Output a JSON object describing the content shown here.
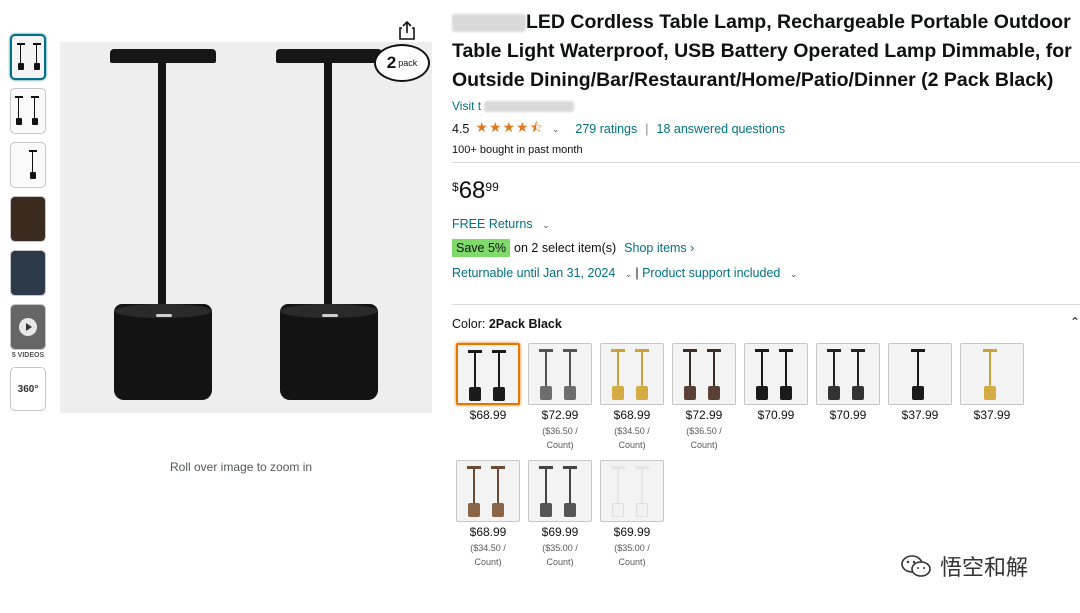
{
  "product": {
    "brand_blurred": "",
    "title": "LED Cordless Table Lamp, Rechargeable Portable Outdoor Table Light Waterproof, USB Battery Operated Lamp Dimmable, for Outside Dining/Bar/Restaurant/Home/Patio/Dinner (2 Pack Black)",
    "store_link": "Visit t",
    "rating_value": "4.5",
    "rating_stars": "★★★★⯪",
    "ratings_count": "279 ratings",
    "answered": "18 answered questions",
    "bought": "100+ bought in past month"
  },
  "price": {
    "symbol": "$",
    "whole": "68",
    "fraction": "99"
  },
  "delivery": {
    "free_returns": "FREE Returns",
    "save_badge": "Save 5%",
    "save_text": "on 2 select item(s)",
    "shop_items": "Shop items ›",
    "returnable": "Returnable until Jan 31, 2024",
    "support": "Product support included"
  },
  "color": {
    "label": "Color:",
    "selected": "2Pack Black"
  },
  "swatches": [
    {
      "price": "$68.99",
      "unit1": "",
      "unit2": "",
      "pole": "#1a1a1a",
      "base": "#1a1a1a",
      "count": 2
    },
    {
      "price": "$72.99",
      "unit1": "($36.50 /",
      "unit2": "Count)",
      "pole": "#555",
      "base": "#6d6d6d",
      "count": 2
    },
    {
      "price": "$68.99",
      "unit1": "($34.50 /",
      "unit2": "Count)",
      "pole": "#c9a33a",
      "base": "#d4ac43",
      "count": 2
    },
    {
      "price": "$72.99",
      "unit1": "($36.50 /",
      "unit2": "Count)",
      "pole": "#3a2c26",
      "base": "#5b4038",
      "count": 2
    },
    {
      "price": "$70.99",
      "unit1": "",
      "unit2": "",
      "pole": "#1a1a1a",
      "base": "#1a1a1a",
      "count": 2
    },
    {
      "price": "$70.99",
      "unit1": "",
      "unit2": "",
      "pole": "#222",
      "base": "#333",
      "count": 2
    },
    {
      "price": "$37.99",
      "unit1": "",
      "unit2": "",
      "pole": "#1a1a1a",
      "base": "#1a1a1a",
      "count": 1
    },
    {
      "price": "$37.99",
      "unit1": "",
      "unit2": "",
      "pole": "#c9a33a",
      "base": "#d4ac43",
      "count": 1
    },
    {
      "price": "$68.99",
      "unit1": "($34.50 /",
      "unit2": "Count)",
      "pole": "#6b4a33",
      "base": "#8a6446",
      "count": 2
    },
    {
      "price": "$69.99",
      "unit1": "($35.00 /",
      "unit2": "Count)",
      "pole": "#444",
      "base": "#555",
      "count": 2
    },
    {
      "price": "$69.99",
      "unit1": "($35.00 /",
      "unit2": "Count)",
      "pole": "#e6e6e6",
      "base": "#f2f2f2",
      "count": 2
    }
  ],
  "gallery": {
    "videos_label": "5 VIDEOS",
    "label_360": "360°",
    "zoom_hint": "Roll over image to zoom in",
    "pack_badge_number": "2",
    "pack_badge_word": "pack"
  },
  "watermark": {
    "text": "悟空和解"
  },
  "colors": {
    "link": "#007185",
    "star": "#de7921",
    "save_badge": "#7fda69",
    "selected_border": "#e77600"
  }
}
